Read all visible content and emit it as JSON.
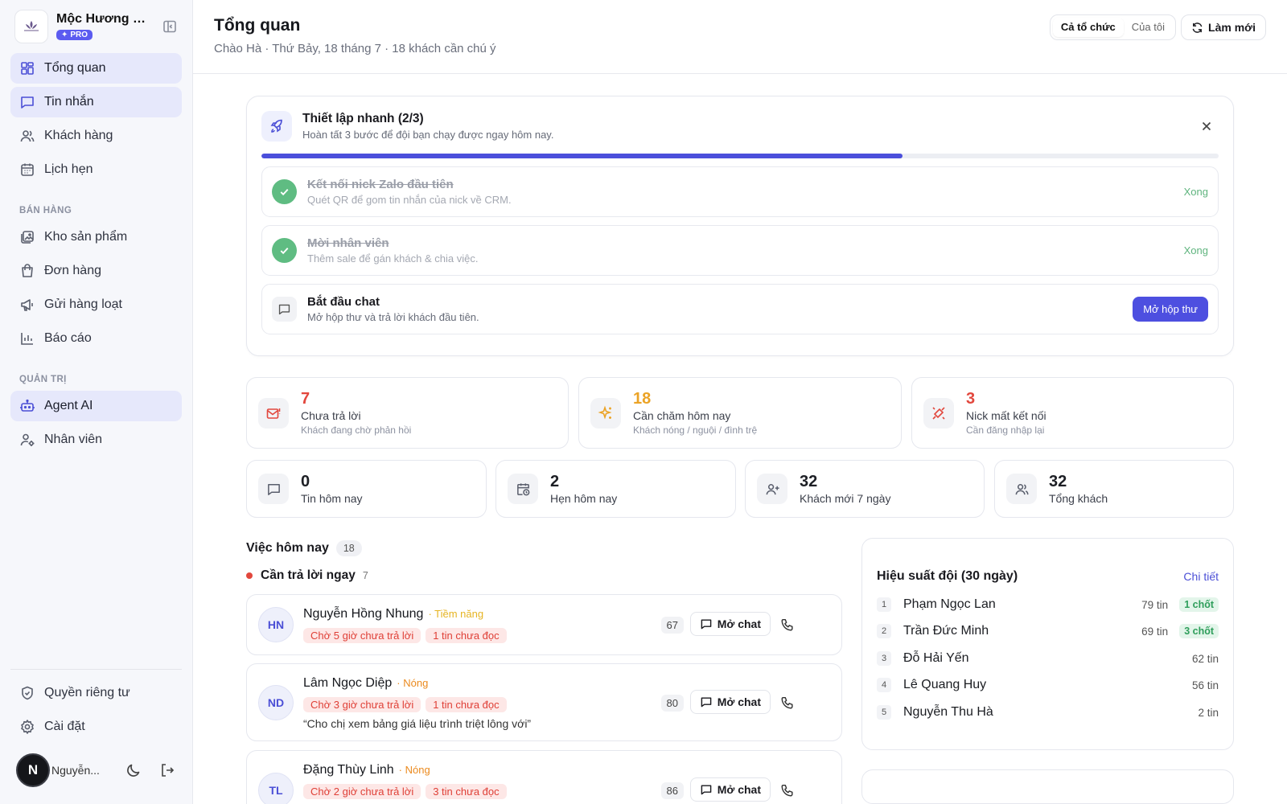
{
  "brand": {
    "name": "Mộc Hương Spa",
    "badge": "PRO"
  },
  "nav": {
    "main": [
      {
        "label": "Tổng quan",
        "icon": "dashboard-icon",
        "active": true
      },
      {
        "label": "Tin nhắn",
        "icon": "message-icon",
        "active": true
      },
      {
        "label": "Khách hàng",
        "icon": "users-icon",
        "active": false
      },
      {
        "label": "Lịch hẹn",
        "icon": "calendar-icon",
        "active": false
      }
    ],
    "sales_section": "BÁN HÀNG",
    "sales": [
      {
        "label": "Kho sản phẩm",
        "icon": "gallery-icon"
      },
      {
        "label": "Đơn hàng",
        "icon": "bag-icon"
      },
      {
        "label": "Gửi hàng loạt",
        "icon": "megaphone-icon"
      },
      {
        "label": "Báo cáo",
        "icon": "bar-chart-icon"
      }
    ],
    "admin_section": "QUẢN TRỊ",
    "admin": [
      {
        "label": "Agent AI",
        "icon": "robot-icon",
        "active": true
      },
      {
        "label": "Nhân viên",
        "icon": "user-settings-icon",
        "active": false
      }
    ],
    "bottom": [
      {
        "label": "Quyền riêng tư",
        "icon": "shield-icon"
      },
      {
        "label": "Cài đặt",
        "icon": "gear-icon"
      }
    ]
  },
  "user": {
    "initial": "N",
    "name": "Nguyễn..."
  },
  "header": {
    "title": "Tổng quan",
    "subtitle": "Chào Hà · Thứ Bảy, 18 tháng 7 · 18 khách cần chú ý",
    "scope_options": [
      "Cả tổ chức",
      "Của tôi"
    ],
    "scope_selected": "Cả tổ chức",
    "refresh_label": "Làm mới"
  },
  "setup": {
    "title": "Thiết lập nhanh (2/3)",
    "subtitle": "Hoàn tất 3 bước để đội bạn chạy được ngay hôm nay.",
    "progress": 0.67,
    "steps": [
      {
        "title": "Kết nối nick Zalo đầu tiên",
        "desc": "Quét QR để gom tin nhắn của nick về CRM.",
        "status": "Xong"
      },
      {
        "title": "Mời nhân viên",
        "desc": "Thêm sale để gán khách & chia việc.",
        "status": "Xong"
      },
      {
        "title": "Bắt đầu chat",
        "desc": "Mở hộp thư và trả lời khách đầu tiên.",
        "action": "Mở hộp thư"
      }
    ]
  },
  "alerts": [
    {
      "value": "7",
      "label": "Chưa trả lời",
      "desc": "Khách đang chờ phản hồi",
      "color": "#e2473d",
      "icon": "mail-alert-icon"
    },
    {
      "value": "18",
      "label": "Cần chăm hôm nay",
      "desc": "Khách nóng / nguội / đình trệ",
      "color": "#eba326",
      "icon": "sparkles-icon"
    },
    {
      "value": "3",
      "label": "Nick mất kết nối",
      "desc": "Cần đăng nhập lại",
      "color": "#e2473d",
      "icon": "unplug-icon"
    }
  ],
  "stats": [
    {
      "value": "0",
      "label": "Tin hôm nay",
      "icon": "message-icon"
    },
    {
      "value": "2",
      "label": "Hẹn hôm nay",
      "icon": "calendar-clock-icon"
    },
    {
      "value": "32",
      "label": "Khách mới 7 ngày",
      "icon": "user-plus-icon"
    },
    {
      "value": "32",
      "label": "Tổng khách",
      "icon": "users-icon"
    }
  ],
  "tasks": {
    "title": "Việc hôm nay",
    "count": "18",
    "group_title": "Cần trả lời ngay",
    "group_count": "7",
    "open_chat_label": "Mở chat",
    "items": [
      {
        "initials": "HN",
        "name": "Nguyễn Hồng Nhung",
        "tag": "· Tiềm năng",
        "tag_color": "#e6b422",
        "badges": [
          "Chờ 5 giờ chưa trả lời",
          "1 tin chưa đọc"
        ],
        "quote": "",
        "score": "67"
      },
      {
        "initials": "ND",
        "name": "Lâm Ngọc Diệp",
        "tag": "· Nóng",
        "tag_color": "#eb8a1e",
        "badges": [
          "Chờ 3 giờ chưa trả lời",
          "1 tin chưa đọc"
        ],
        "quote": "“Cho chị xem bảng giá liệu trình triệt lông với”",
        "score": "80"
      },
      {
        "initials": "TL",
        "name": "Đặng Thùy Linh",
        "tag": "· Nóng",
        "tag_color": "#eb8a1e",
        "badges": [
          "Chờ 2 giờ chưa trả lời",
          "3 tin chưa đọc"
        ],
        "quote": "",
        "score": "86"
      }
    ]
  },
  "performance": {
    "title": "Hiệu suất đội (30 ngày)",
    "link": "Chi tiết",
    "rows": [
      {
        "rank": "1",
        "name": "Phạm Ngọc Lan",
        "messages": "79 tin",
        "closed": "1 chốt"
      },
      {
        "rank": "2",
        "name": "Trần Đức Minh",
        "messages": "69 tin",
        "closed": "3 chốt"
      },
      {
        "rank": "3",
        "name": "Đỗ Hải Yến",
        "messages": "62 tin",
        "closed": ""
      },
      {
        "rank": "4",
        "name": "Lê Quang Huy",
        "messages": "56 tin",
        "closed": ""
      },
      {
        "rank": "5",
        "name": "Nguyễn Thu Hà",
        "messages": "2 tin",
        "closed": ""
      }
    ]
  }
}
